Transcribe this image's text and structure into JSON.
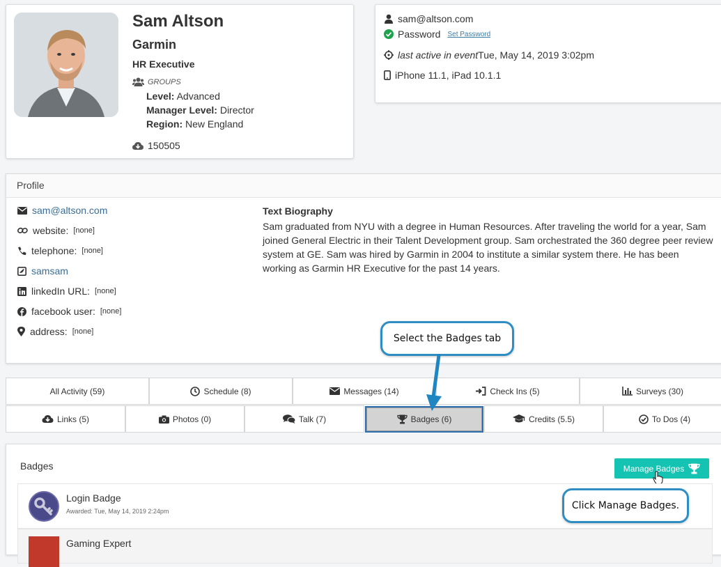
{
  "profile": {
    "name": "Sam Altson",
    "company": "Garmin",
    "job_title": "HR Executive",
    "groups_label": "GROUPS",
    "groups": [
      {
        "label": "Level:",
        "value": "Advanced"
      },
      {
        "label": "Manager Level:",
        "value": "Director"
      },
      {
        "label": "Region:",
        "value": "New England"
      }
    ],
    "points": "150505"
  },
  "contact": {
    "email": "sam@altson.com",
    "password_label": "Password",
    "set_password": "Set Password",
    "last_active_label": "last active in event",
    "last_active_value": "Tue, May 14, 2019 3:02pm",
    "devices": "iPhone 11.1, iPad 10.1.1"
  },
  "profile_section": {
    "header": "Profile",
    "email": "sam@altson.com",
    "website_label": "website:",
    "website_value": "[none]",
    "telephone_label": "telephone:",
    "telephone_value": "[none]",
    "twitter": "samsam",
    "linkedin_label": "linkedIn URL:",
    "linkedin_value": "[none]",
    "facebook_label": "facebook user:",
    "facebook_value": "[none]",
    "address_label": "address:",
    "address_value": "[none]",
    "bio_title": "Text Biography",
    "bio_text": "Sam graduated from NYU with a degree in Human Resources. After traveling the world for a year, Sam joined General Electric in their Talent Development group. Sam orchestrated the 360 degree peer review system at GE. Sam was hired by Garmin in 2004 to institute a similar system there. He has been working as Garmin HR Executive for the past 14 years."
  },
  "callouts": {
    "badges_tab": "Select the Badges tab",
    "manage_badges": "Click Manage Badges."
  },
  "tabs_row1": [
    {
      "label": "All Activity (59)",
      "icon": "none"
    },
    {
      "label": "Schedule (8)",
      "icon": "clock-icon"
    },
    {
      "label": "Messages (14)",
      "icon": "envelope-icon"
    },
    {
      "label": "Check Ins (5)",
      "icon": "sign-in-icon"
    },
    {
      "label": "Surveys (30)",
      "icon": "bar-chart-icon"
    }
  ],
  "tabs_row2": [
    {
      "label": "Links (5)",
      "icon": "cloud-download-icon"
    },
    {
      "label": "Photos (0)",
      "icon": "camera-icon"
    },
    {
      "label": "Talk (7)",
      "icon": "comments-icon"
    },
    {
      "label": "Badges (6)",
      "icon": "trophy-icon",
      "active": true
    },
    {
      "label": "Credits (5.5)",
      "icon": "graduation-cap-icon"
    },
    {
      "label": "To Dos (4)",
      "icon": "check-circle-icon"
    }
  ],
  "badges": {
    "title": "Badges",
    "manage_button": "Manage Badges",
    "items": [
      {
        "name": "Login Badge",
        "awarded": "Awarded: Tue, May 14, 2019 2:24pm",
        "icon": "key-icon"
      },
      {
        "name": "Gaming Expert",
        "awarded": "",
        "icon": "shield-icon"
      }
    ]
  },
  "colors": {
    "callout_border": "#2e8ec4",
    "manage_button": "#14c3b1",
    "link": "#3a6d96",
    "active_tab": "#d3d3d3",
    "badge_key": "#4a4a8a",
    "password_ok": "#1ea34a"
  }
}
